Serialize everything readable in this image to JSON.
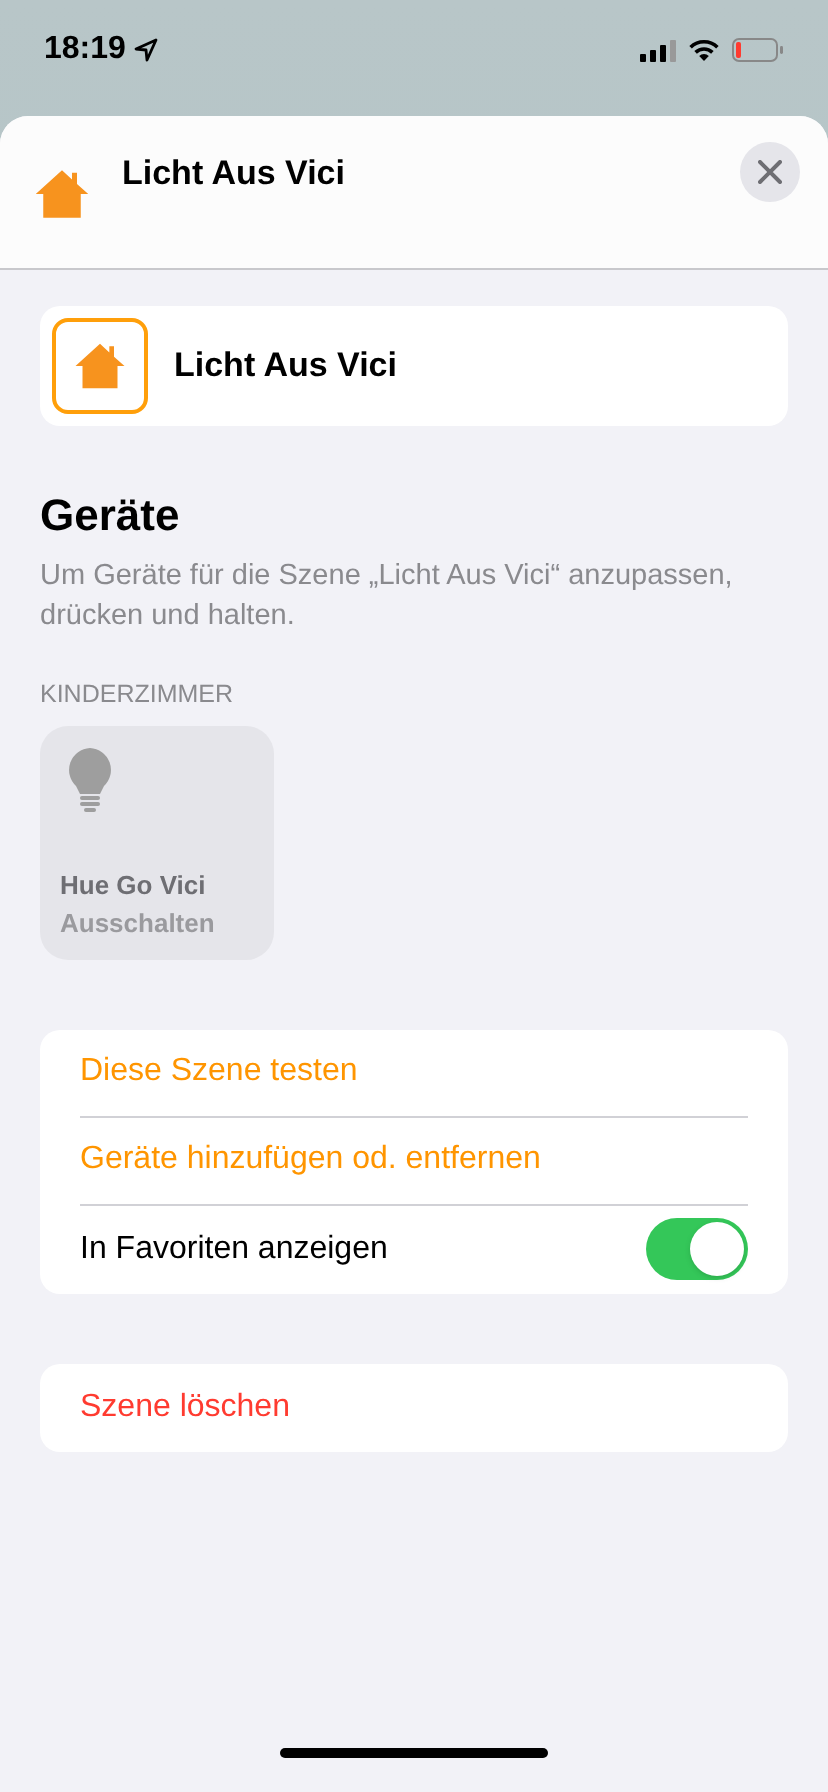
{
  "status_bar": {
    "time": "18:19"
  },
  "header": {
    "title": "Licht Aus Vici"
  },
  "scene": {
    "name": "Licht Aus Vici"
  },
  "devices": {
    "title": "Geräte",
    "description": "Um Geräte für die Szene „Licht Aus Vici“ anzupassen, drücken und halten.",
    "room": "KINDERZIMMER",
    "items": [
      {
        "name": "Hue Go Vici",
        "state": "Ausschalten"
      }
    ]
  },
  "actions": [
    {
      "kind": "action",
      "label": "Diese Szene testen"
    },
    {
      "kind": "action",
      "label": "Geräte hinzufügen od. entfernen"
    },
    {
      "kind": "toggle",
      "label": "In Favoriten anzeigen",
      "on": true
    }
  ],
  "danger": [
    {
      "kind": "destructive",
      "label": "Szene löschen"
    }
  ]
}
